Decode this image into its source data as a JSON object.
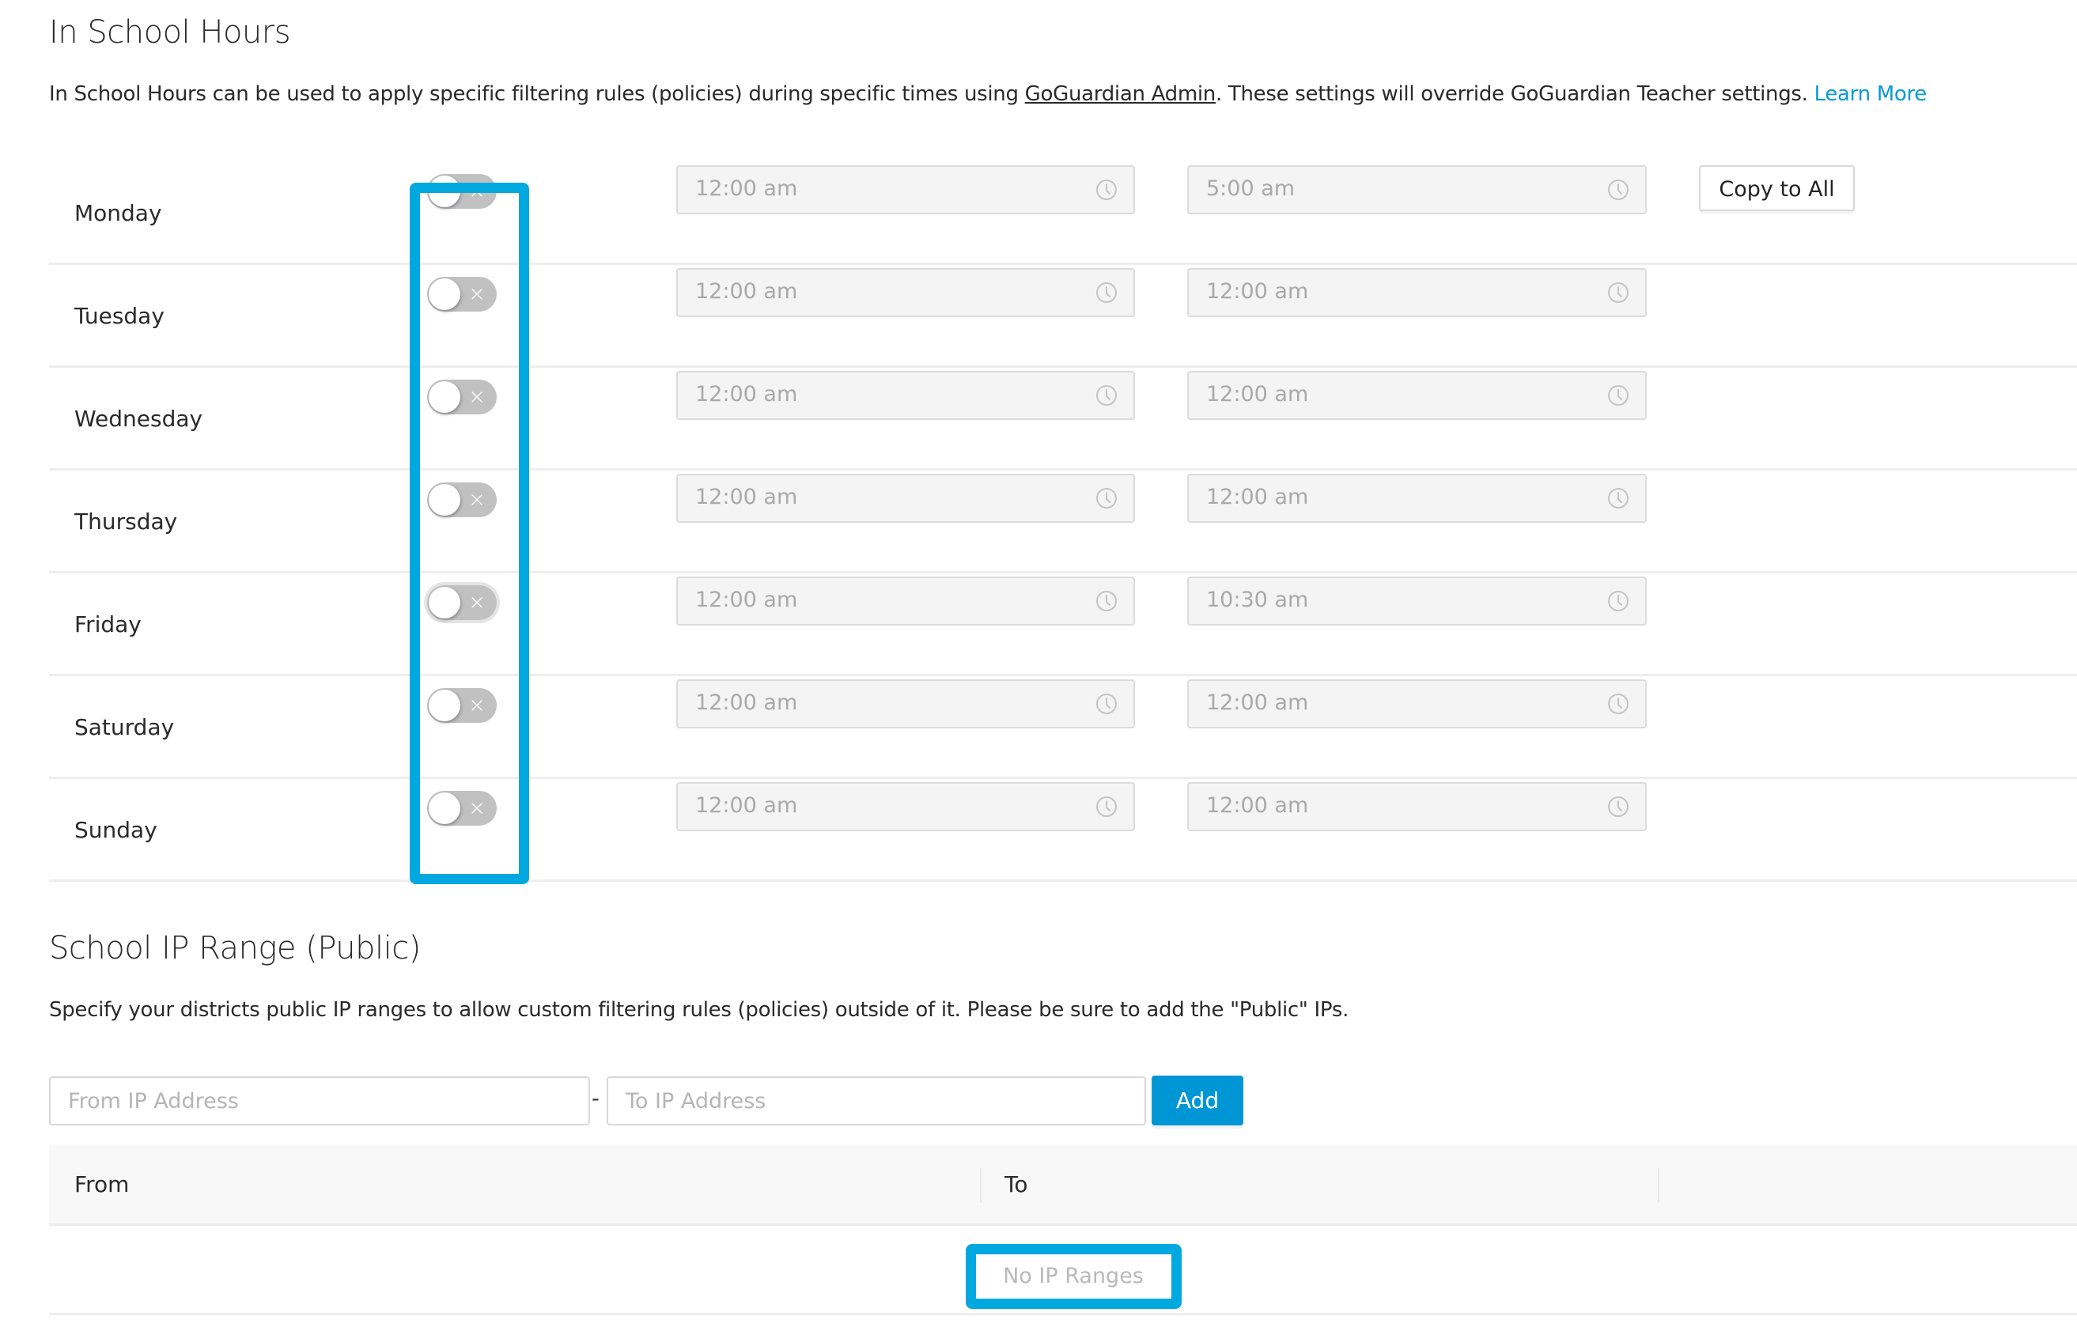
{
  "school_hours": {
    "title": "In School Hours",
    "description_pre": "In School Hours can be used to apply specific filtering rules (policies) during specific times using ",
    "description_link": "GoGuardian Admin",
    "description_post": ". These settings will override GoGuardian Teacher settings. ",
    "learn_more": "Learn More",
    "copy_to_all_label": "Copy to All",
    "days": [
      {
        "name": "Monday",
        "enabled": false,
        "start": "12:00 am",
        "end": "5:00 am"
      },
      {
        "name": "Tuesday",
        "enabled": false,
        "start": "12:00 am",
        "end": "12:00 am"
      },
      {
        "name": "Wednesday",
        "enabled": false,
        "start": "12:00 am",
        "end": "12:00 am"
      },
      {
        "name": "Thursday",
        "enabled": false,
        "start": "12:00 am",
        "end": "12:00 am"
      },
      {
        "name": "Friday",
        "enabled": false,
        "start": "12:00 am",
        "end": "10:30 am"
      },
      {
        "name": "Saturday",
        "enabled": false,
        "start": "12:00 am",
        "end": "12:00 am"
      },
      {
        "name": "Sunday",
        "enabled": false,
        "start": "12:00 am",
        "end": "12:00 am"
      }
    ],
    "toggle_off_glyph": "×",
    "time_icon": "clock-icon"
  },
  "ip_range": {
    "title": "School IP Range (Public)",
    "description": "Specify your districts public IP ranges to allow custom filtering rules (policies) outside of it. Please be sure to add the \"Public\" IPs.",
    "from_placeholder": "From IP Address",
    "to_placeholder": "To IP Address",
    "separator": "-",
    "add_label": "Add",
    "columns": [
      "From",
      "To",
      ""
    ],
    "empty_message": "No IP Ranges",
    "rows": []
  },
  "colors": {
    "accent": "#0096d6",
    "link": "#0a9ad6",
    "highlight": "#00a8e0",
    "toggle_off": "#c1c1c1"
  }
}
